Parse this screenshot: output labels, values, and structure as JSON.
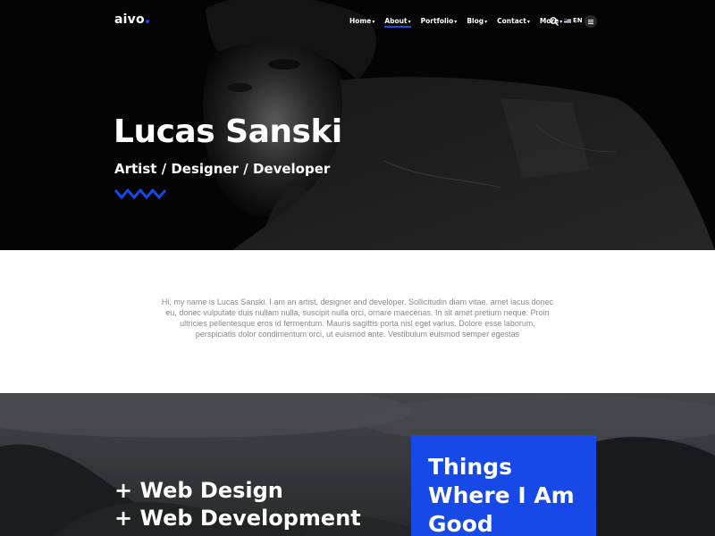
{
  "brand": {
    "logo": "aivo",
    "accent_color": "#1748e8"
  },
  "nav": {
    "items": [
      {
        "label": "Home",
        "active": false
      },
      {
        "label": "About",
        "active": true
      },
      {
        "label": "Portfolio",
        "active": false
      },
      {
        "label": "Blog",
        "active": false
      },
      {
        "label": "Contact",
        "active": false
      },
      {
        "label": "More",
        "active": false
      }
    ],
    "search_icon": "search-icon",
    "language": {
      "label": "EN",
      "flag_icon": "us-flag-icon"
    },
    "menu_icon": "hamburger-icon"
  },
  "hero": {
    "title": "Lucas Sanski",
    "subtitle": "Artist / Designer / Developer",
    "decoration_icon": "zigzag-icon"
  },
  "intro": {
    "text": "Hi, my name is Lucas Sanski. I am an artist, designer and developer. Sollicitudin diam vitae, amet lacus donec eu, donec vulputate duis nullam nulla, suscipit nulla orci, ornare maecenas. In sit amet pretium neque. Proin ultricies pellentesque eros id fermentum. Mauris sagittis porta nisl eget varius. Dolore esse laborum, perspiciatis dolor condimentum orci, ut euismod ante. Vestibulum euismod semper egestas"
  },
  "services": {
    "items": [
      "+ Web Design",
      "+ Web Development"
    ],
    "highlight_title": "Things Where I Am Good"
  }
}
